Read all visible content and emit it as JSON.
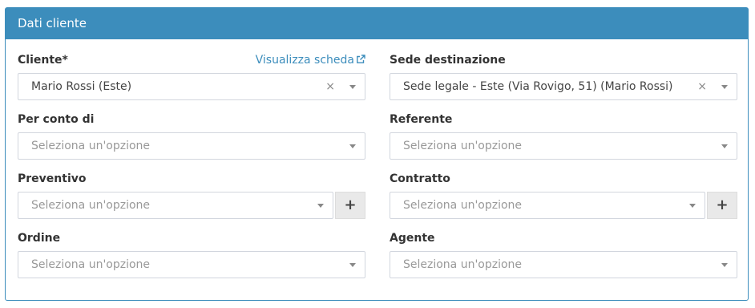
{
  "panel": {
    "title": "Dati cliente"
  },
  "fields": {
    "cliente": {
      "label": "Cliente*",
      "link": "Visualizza scheda",
      "value": "Mario Rossi (Este)",
      "clear": "×"
    },
    "sede_destinazione": {
      "label": "Sede destinazione",
      "value": "Sede legale - Este (Via Rovigo, 51) (Mario Rossi)",
      "clear": "×"
    },
    "per_conto_di": {
      "label": "Per conto di",
      "placeholder": "Seleziona un'opzione"
    },
    "referente": {
      "label": "Referente",
      "placeholder": "Seleziona un'opzione"
    },
    "preventivo": {
      "label": "Preventivo",
      "placeholder": "Seleziona un'opzione",
      "add_label": "+"
    },
    "contratto": {
      "label": "Contratto",
      "placeholder": "Seleziona un'opzione",
      "add_label": "+"
    },
    "ordine": {
      "label": "Ordine",
      "placeholder": "Seleziona un'opzione"
    },
    "agente": {
      "label": "Agente",
      "placeholder": "Seleziona un'opzione"
    }
  },
  "icons": {
    "external_link": "external-link-icon",
    "dropdown": "caret-down-icon"
  },
  "colors": {
    "header_bg": "#3c8dbc",
    "link": "#3c8dbc",
    "border": "#d2d6de"
  }
}
